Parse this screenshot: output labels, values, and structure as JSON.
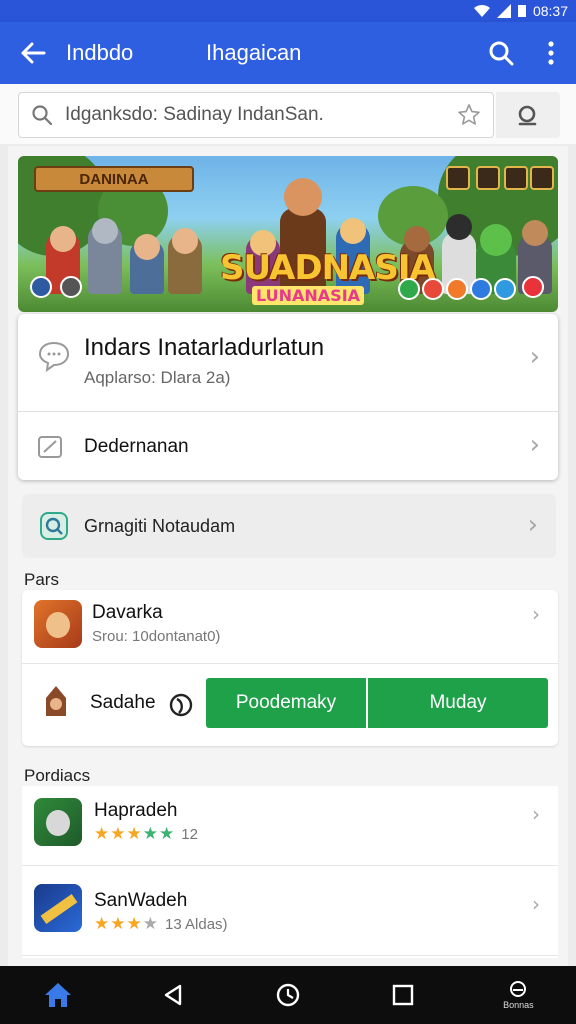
{
  "status": {
    "time": "08:37"
  },
  "app_bar": {
    "title_left": "Indbdo",
    "title_center": "Ihagaican"
  },
  "search": {
    "value": "Idganksdo: Sadinay IndanSan."
  },
  "banner": {
    "top_label": "DANINAA",
    "logo_main": "SUADNASIA",
    "logo_sub": "LUNANASIA"
  },
  "card1": {
    "title": "Indars Inatarladurlatun",
    "subtitle": "Aqplarso: Dlara 2a)",
    "row2_label": "Dedernanan"
  },
  "card2": {
    "label": "Grnagiti Notaudam"
  },
  "section1": {
    "label": "Pars"
  },
  "game1": {
    "title": "Davarka",
    "subtitle": "Srou: 10dontanat0)"
  },
  "game2": {
    "title": "Sadahe",
    "btn_primary": "Poodemaky",
    "btn_secondary": "Muday"
  },
  "section2": {
    "label": "Pordiacs"
  },
  "game3": {
    "title": "Hapradeh",
    "rating": 3.5,
    "count": "12"
  },
  "game4": {
    "title": "SanWadeh",
    "rating": 2.5,
    "count": "13 Aldas)"
  },
  "nav": {
    "item5_label": "Bonnas"
  },
  "colors": {
    "primary": "#2e5fe0",
    "accent_green": "#1fa14a",
    "star": "#f5a623",
    "star_green": "#3cb371"
  }
}
